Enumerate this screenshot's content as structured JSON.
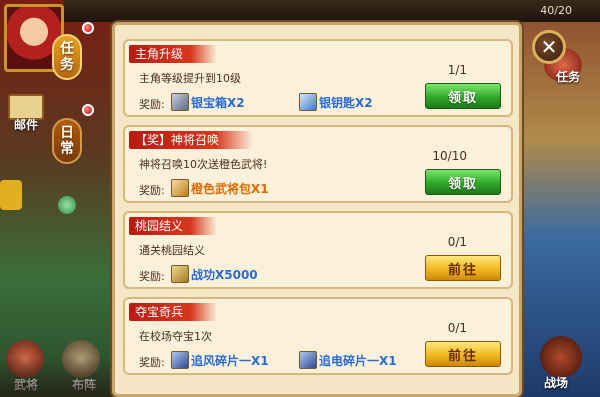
{
  "hud": {
    "level": "",
    "energy": "40/20"
  },
  "tabs": [
    {
      "label_top": "任",
      "label_bottom": "务"
    },
    {
      "label_top": "日",
      "label_bottom": "常"
    }
  ],
  "side_left": {
    "mail": "邮件",
    "general": "武将",
    "formation": "布阵"
  },
  "side_right": {
    "task": "任务",
    "battlefield": "战场"
  },
  "close_symbol": "✕",
  "quests": [
    {
      "title": "主角升级",
      "description": "主角等级提升到10级",
      "progress": "1/1",
      "reward_label": "奖励:",
      "rewards": [
        {
          "icon": "silver-chest-icon",
          "text": "银宝箱X2",
          "style": "blue"
        },
        {
          "icon": "silver-key-icon",
          "text": "银钥匙X2",
          "style": "blue"
        }
      ],
      "button": "领取",
      "button_style": "green"
    },
    {
      "title": "【奖】神将召唤",
      "description": "神将召唤10次送橙色武将!",
      "progress": "10/10",
      "reward_label": "奖励:",
      "rewards": [
        {
          "icon": "general-pack-icon",
          "text": "橙色武将包X1",
          "style": "orange"
        }
      ],
      "button": "领取",
      "button_style": "green"
    },
    {
      "title": "桃园结义",
      "description": "通关桃园结义",
      "progress": "0/1",
      "reward_label": "奖励:",
      "rewards": [
        {
          "icon": "merit-icon",
          "text": "战功X5000",
          "style": "blue"
        }
      ],
      "button": "前往",
      "button_style": "yellow"
    },
    {
      "title": "夺宝奇兵",
      "description": "在校场夺宝1次",
      "progress": "0/1",
      "reward_label": "奖励:",
      "rewards": [
        {
          "icon": "fragment-icon",
          "text": "追风碎片一X1",
          "style": "blue"
        },
        {
          "icon": "fragment-icon",
          "text": "追电碎片一X1",
          "style": "blue"
        }
      ],
      "button": "前往",
      "button_style": "yellow"
    }
  ],
  "colors": {
    "panel_bg": "#f4e6c6",
    "title_red": "#b81c12",
    "reward_blue": "#2a6ad0",
    "reward_orange": "#e06a00"
  }
}
